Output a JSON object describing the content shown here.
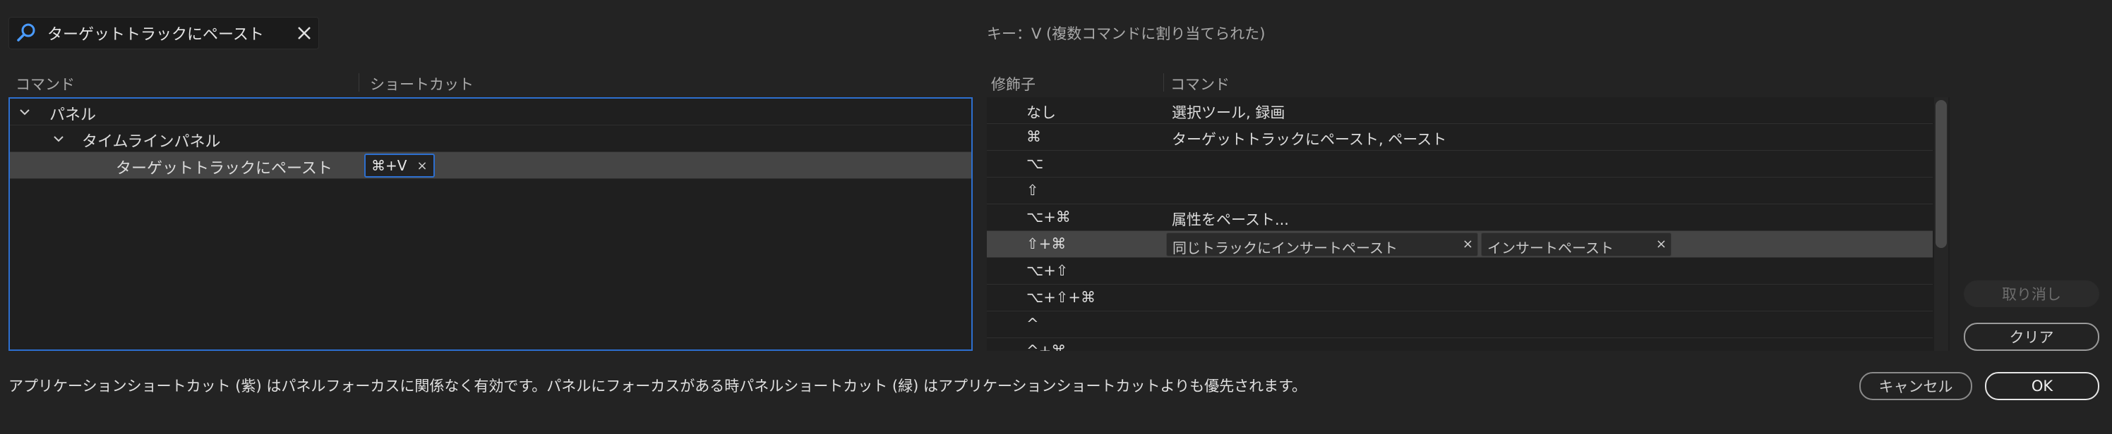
{
  "search": {
    "value": "ターゲットトラックにペースト"
  },
  "key_info": "キー：V (複数コマンドに割り当てられた)",
  "left_table": {
    "columns": [
      "コマンド",
      "ショートカット"
    ],
    "rows": [
      {
        "label": "パネル",
        "expanded": true
      },
      {
        "label": "タイムラインパネル",
        "expanded": true
      },
      {
        "label": "ターゲットトラックにペースト",
        "shortcut": "⌘+V",
        "selected": true
      }
    ]
  },
  "right_table": {
    "columns": [
      "修飾子",
      "コマンド"
    ],
    "rows": [
      {
        "modifier": "なし",
        "command": "選択ツール, 録画"
      },
      {
        "modifier": "⌘",
        "command": "ターゲットトラックにペースト, ペースト"
      },
      {
        "modifier": "⌥",
        "command": ""
      },
      {
        "modifier": "⇧",
        "command": ""
      },
      {
        "modifier": "⌥+⌘",
        "command": "属性をペースト..."
      },
      {
        "modifier": "⇧+⌘",
        "command": "",
        "chips": [
          "同じトラックにインサートペースト",
          "インサートペースト"
        ],
        "selected": true
      },
      {
        "modifier": "⌥+⇧",
        "command": ""
      },
      {
        "modifier": "⌥+⇧+⌘",
        "command": ""
      },
      {
        "modifier": "^",
        "command": ""
      },
      {
        "modifier": "^+⌘",
        "command": ""
      }
    ]
  },
  "buttons": {
    "undo": "取り消し",
    "clear": "クリア",
    "cancel": "キャンセル",
    "ok": "OK"
  },
  "footer_note": "アプリケーションショートカット (紫) はパネルフォーカスに関係なく有効です。パネルにフォーカスがある時パネルショートカット (緑) はアプリケーションショートカットよりも優先されます。",
  "colors": {
    "background": "#232323",
    "accent": "#2d6fcf"
  }
}
